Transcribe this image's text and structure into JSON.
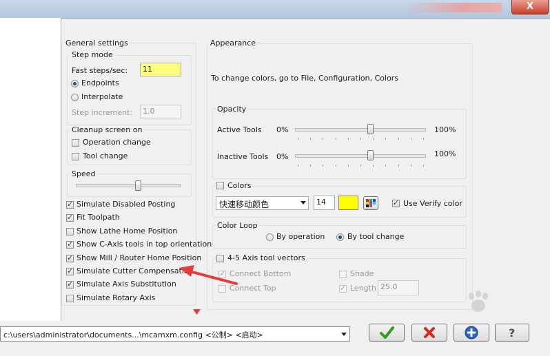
{
  "window": {
    "close_label": "X"
  },
  "general": {
    "title": "General settings",
    "step_mode": {
      "title": "Step mode",
      "fast_steps_label": "Fast steps/sec:",
      "fast_steps_value": "11",
      "endpoints_label": "Endpoints",
      "interpolate_label": "Interpolate",
      "step_increment_label": "Step increment:",
      "step_increment_value": "1.0"
    },
    "cleanup": {
      "title": "Cleanup screen on",
      "operation_change": "Operation change",
      "tool_change": "Tool change"
    },
    "speed": {
      "title": "Speed",
      "value": 0.6
    },
    "options": [
      {
        "label": "Simulate Disabled Posting",
        "checked": true
      },
      {
        "label": "Fit Toolpath",
        "checked": true
      },
      {
        "label": "Show Lathe Home Position",
        "checked": false
      },
      {
        "label": "Show C-Axis tools in top orientation",
        "checked": true
      },
      {
        "label": "Show Mill / Router Home Position",
        "checked": true
      },
      {
        "label": "Simulate Cutter Compensation",
        "checked": true
      },
      {
        "label": "Simulate Axis Substitution",
        "checked": true
      },
      {
        "label": "Simulate Rotary Axis",
        "checked": false
      }
    ]
  },
  "appearance": {
    "title": "Appearance",
    "info": "To change colors, go to File, Configuration, Colors",
    "opacity": {
      "title": "Opacity",
      "active_label": "Active Tools",
      "inactive_label": "Inactive Tools",
      "min_label": "0%",
      "max_label": "100%",
      "active_value": 0.58,
      "inactive_value": 0.58
    },
    "colors": {
      "title": "Colors",
      "dropdown_value": "快速移动颜色",
      "number_value": "14",
      "swatch_color": "#ffff00",
      "verify_label": "Use Verify color"
    },
    "color_loop": {
      "title": "Color Loop",
      "by_operation": "By operation",
      "by_tool_change": "By tool change"
    },
    "axis_vectors": {
      "title": "4-5 Axis tool vectors",
      "connect_bottom": "Connect Bottom",
      "connect_top": "Connect Top",
      "shade": "Shade",
      "length": "Length",
      "length_value": "25.0"
    }
  },
  "status": {
    "config_path": "c:\\users\\administrator\\documents...\\mcamxm.config <公制> <启动>"
  },
  "buttons": {
    "ok_icon": "check-icon",
    "cancel_icon": "cross-icon",
    "apply_icon": "plus-icon",
    "help_icon": "question-icon"
  },
  "colors": {
    "highlight": "#ffff80",
    "arrow": "#e83a3a",
    "accent": "#1d4a88"
  }
}
